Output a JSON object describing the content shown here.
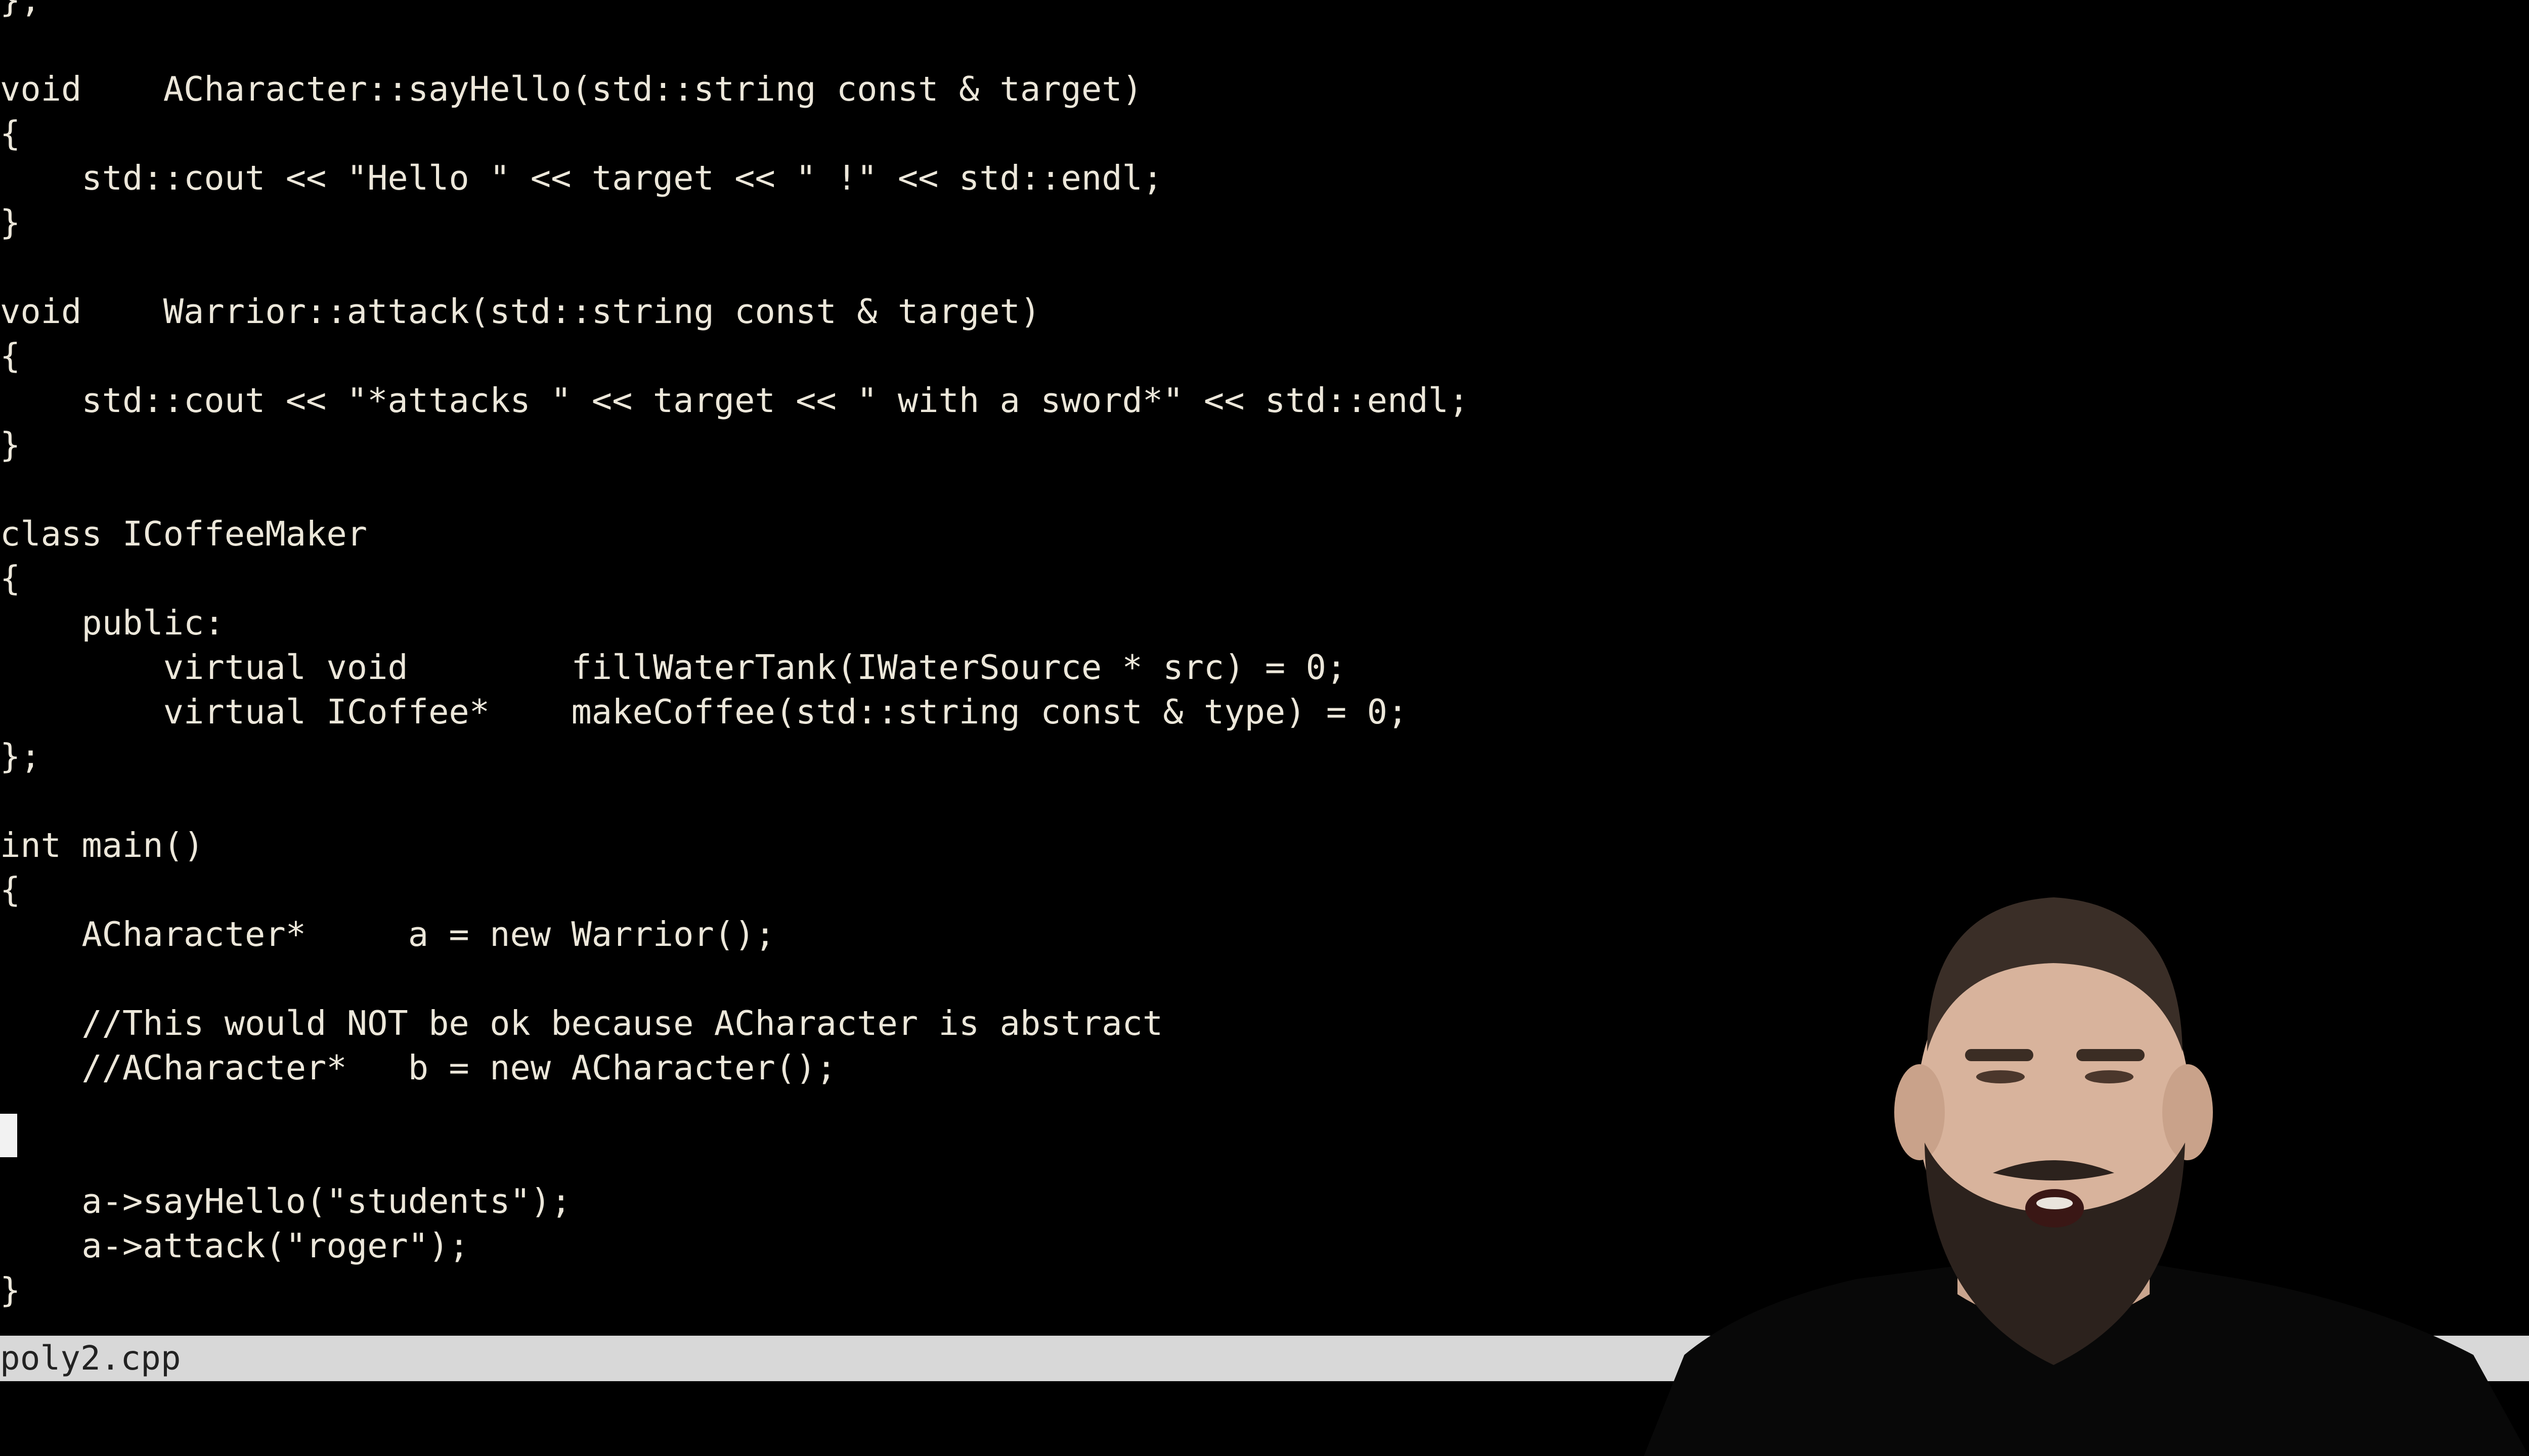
{
  "editor": {
    "lines": [
      "};",
      "",
      "void    ACharacter::sayHello(std::string const & target)",
      "{",
      "    std::cout << \"Hello \" << target << \" !\" << std::endl;",
      "}",
      "",
      "void    Warrior::attack(std::string const & target)",
      "{",
      "    std::cout << \"*attacks \" << target << \" with a sword*\" << std::endl;",
      "}",
      "",
      "class ICoffeeMaker",
      "{",
      "    public:",
      "        virtual void        fillWaterTank(IWaterSource * src) = 0;",
      "        virtual ICoffee*    makeCoffee(std::string const & type) = 0;",
      "};",
      "",
      "int main()",
      "{",
      "    ACharacter*     a = new Warrior();",
      "",
      "    //This would NOT be ok because ACharacter is abstract",
      "    //ACharacter*   b = new ACharacter();",
      "",
      "",
      "    a->sayHello(\"students\");",
      "    a->attack(\"roger\");",
      "}"
    ]
  },
  "status_bar": {
    "filename": "poly2.cpp"
  },
  "colors": {
    "background": "#000000",
    "code_text": "#ece7da",
    "status_bar": "#d8d8d8",
    "status_text": "#222222",
    "cursor": "#f2f2f2"
  },
  "overlay": {
    "icon": "presenter-webcam"
  }
}
